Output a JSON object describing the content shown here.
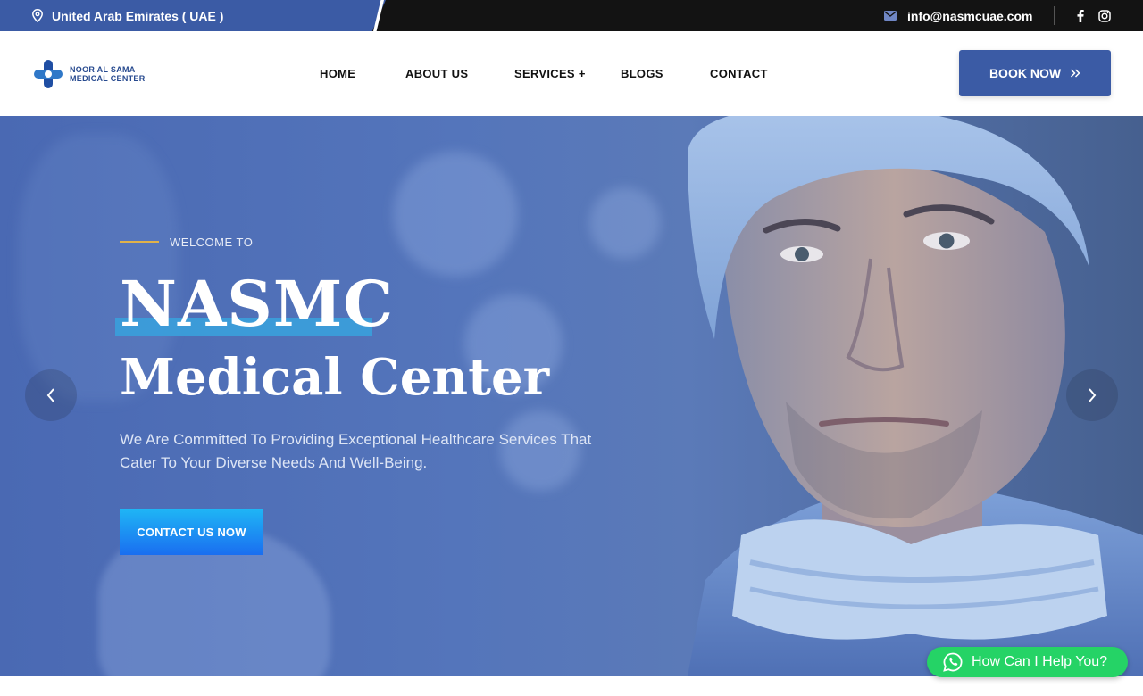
{
  "topbar": {
    "location": "United Arab Emirates ( UAE )",
    "email": "info@nasmcuae.com",
    "social": [
      "facebook-icon",
      "instagram-icon"
    ]
  },
  "header": {
    "logo": {
      "line1": "NOOR AL SAMA",
      "line2": "MEDICAL CENTER"
    },
    "nav": [
      {
        "label": "HOME"
      },
      {
        "label": "ABOUT US"
      },
      {
        "label": "SERVICES +"
      },
      {
        "label": "BLOGS"
      },
      {
        "label": "CONTACT"
      }
    ],
    "book_button": {
      "label": "BOOK NOW",
      "icon": "double-chevron-right-icon"
    }
  },
  "hero": {
    "welcome": "WELCOME TO",
    "title_line1": "NASMC",
    "title_line2": "Medical Center",
    "description": "We Are Committed To Providing Exceptional Healthcare Services That Cater To Your Diverse Needs And Well-Being.",
    "cta_label": "CONTACT US NOW",
    "prev_icon": "chevron-left-icon",
    "next_icon": "chevron-right-icon"
  },
  "whatsapp": {
    "label": "How Can I Help You?",
    "icon": "whatsapp-icon"
  },
  "colors": {
    "brand_blue": "#3b5ba5",
    "topbar_dark": "#131313",
    "accent_gold": "#e0b24a",
    "title_highlight": "#3aa0dc",
    "cta_gradient_top": "#1fb6f5",
    "cta_gradient_bottom": "#1a6ef0",
    "whatsapp_green": "#25d366"
  }
}
